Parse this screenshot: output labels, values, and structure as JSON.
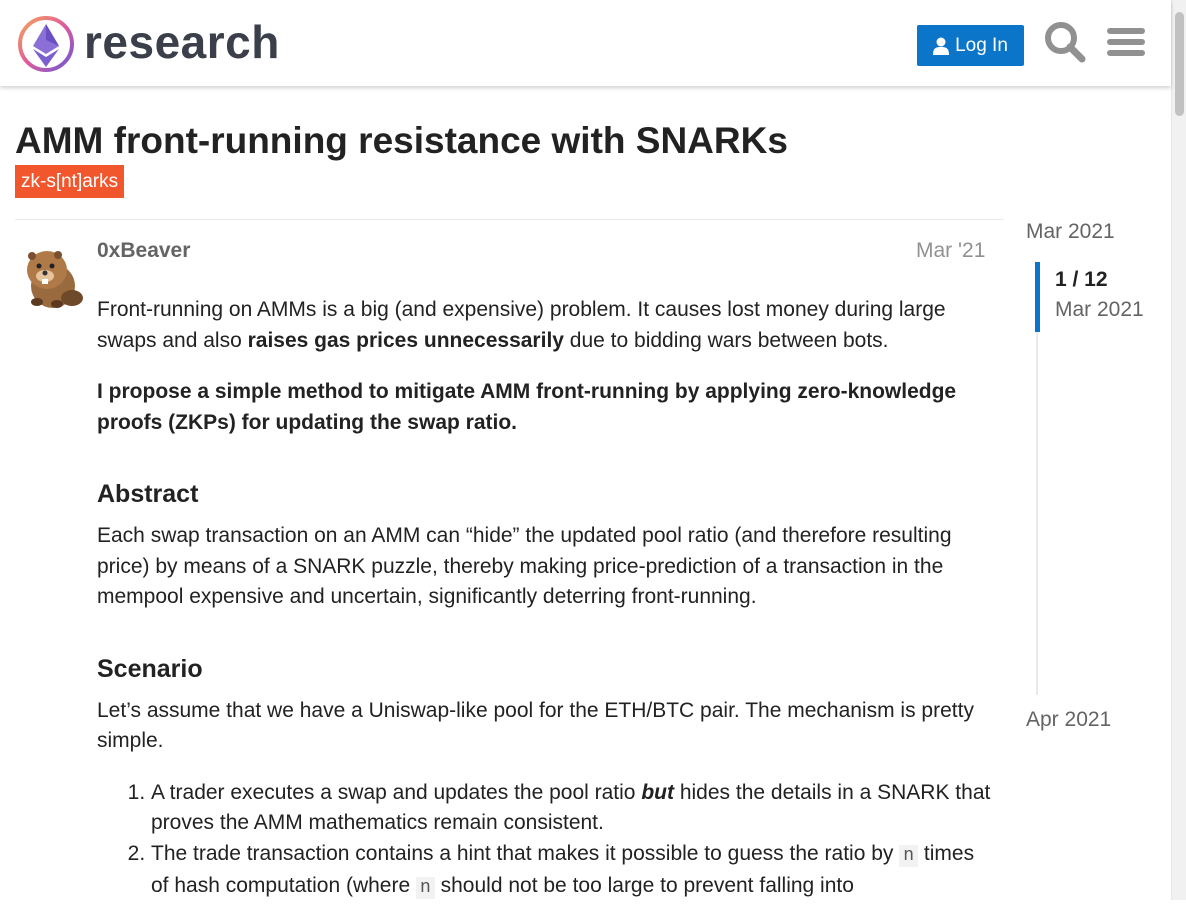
{
  "header": {
    "logo_text": "research",
    "login_label": "Log In",
    "icons": [
      "user-icon",
      "search-icon",
      "hamburger-menu-icon"
    ],
    "colors": {
      "login_bg": "#0a75c9",
      "logo_text": "#3a3f4a"
    }
  },
  "topic": {
    "title": "AMM front-running resistance with SNARKs",
    "tag": "zk-s[nt]arks",
    "tag_color": "#f2562c"
  },
  "post": {
    "username": "0xBeaver",
    "date": "Mar '21",
    "p1_a": "Front-running on AMMs is a big (and expensive) problem. It causes lost money during large swaps and also ",
    "p1_bold": "raises gas prices unnecessarily",
    "p1_b": " due to bidding wars between bots.",
    "p2_bold": "I propose a simple method to mitigate AMM front-running by applying zero-knowledge proofs (ZKPs) for updating the swap ratio.",
    "h_abstract": "Abstract",
    "abstract": "Each swap transaction on an AMM can “hide” the updated pool ratio (and therefore resulting price) by means of a SNARK puzzle, thereby making price-prediction of a transaction in the mempool expensive and uncertain, significantly deterring front-running.",
    "h_scenario": "Scenario",
    "scenario": "Let’s assume that we have a Uniswap-like pool for the ETH/BTC pair. The mechanism is pretty simple.",
    "li1_a": "A trader executes a swap and updates the pool ratio ",
    "li1_em": "but",
    "li1_b": " hides the details in a SNARK that proves the AMM mathematics remain consistent.",
    "li2_a": "The trade transaction contains a hint that makes it possible to guess the ratio by ",
    "li2_code1": "n",
    "li2_b": " times of hash computation (where ",
    "li2_code2": "n",
    "li2_c": " should not be too large to prevent falling into"
  },
  "timeline": {
    "start": "Mar 2021",
    "count": "1 / 12",
    "count_date": "Mar 2021",
    "end": "Apr 2021",
    "progress_fraction": 0.083
  }
}
